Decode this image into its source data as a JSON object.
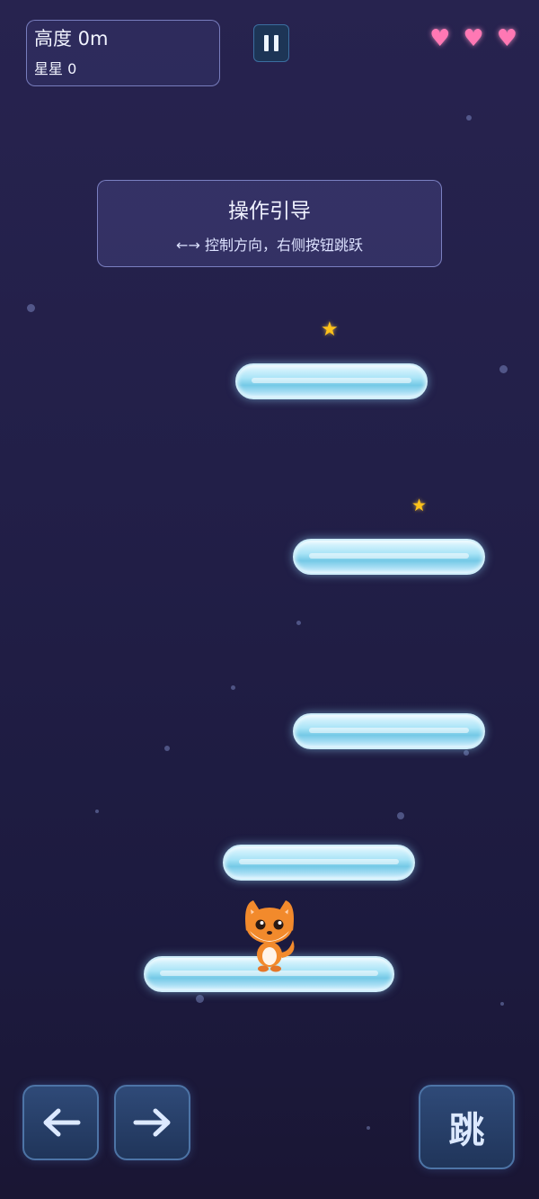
{
  "hud": {
    "height_text": "高度 0m",
    "stars_text": "星星 0"
  },
  "lives": {
    "count": 3,
    "icon": "heart-icon",
    "color": "#ff78b4"
  },
  "guide": {
    "title": "操作引导",
    "hint": "←→ 控制方向，右侧按钮跳跃"
  },
  "controls": {
    "left_icon": "arrow-left-icon",
    "right_icon": "arrow-right-icon",
    "jump_label": "跳"
  },
  "colors": {
    "star": "#ffc21a",
    "fox": "#f28a2c"
  }
}
